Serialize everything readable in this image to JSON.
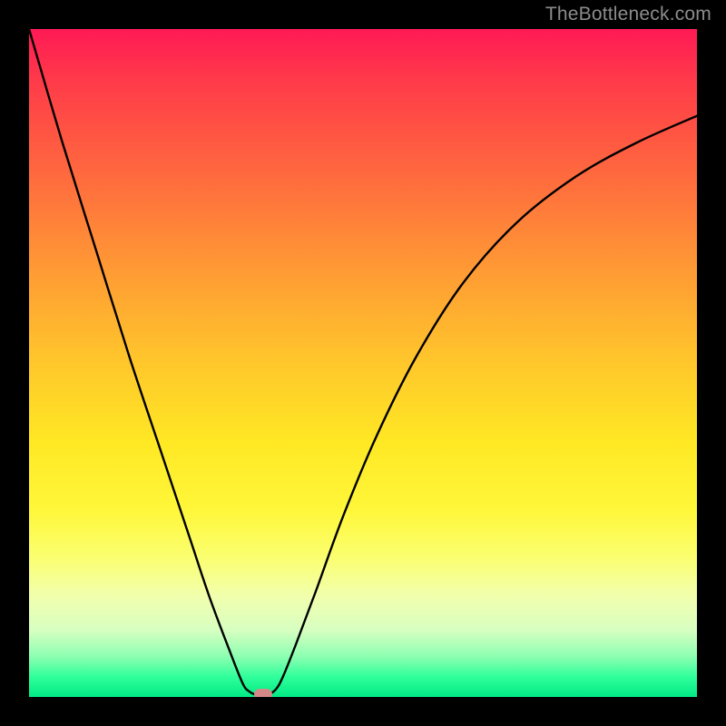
{
  "watermark": {
    "text": "TheBottleneck.com"
  },
  "colors": {
    "frame": "#000000",
    "curve": "#000000",
    "marker": "#d48888",
    "gradient_stops": [
      "#ff1a55",
      "#ff6a3e",
      "#ffc72b",
      "#fff73a",
      "#f1ffae",
      "#2fff9a",
      "#00ea86"
    ]
  },
  "chart_data": {
    "type": "line",
    "title": "",
    "xlabel": "",
    "ylabel": "",
    "xlim": [
      0,
      100
    ],
    "ylim": [
      0,
      100
    ],
    "grid": false,
    "legend": false,
    "series": [
      {
        "name": "bottleneck_curve",
        "x": [
          0,
          5,
          10,
          15,
          20,
          24,
          27,
          30,
          32,
          33,
          34,
          35,
          36,
          37,
          38,
          40,
          43,
          47,
          52,
          58,
          65,
          73,
          82,
          91,
          100
        ],
        "values": [
          100,
          83,
          67,
          51,
          36,
          24,
          15,
          7,
          2,
          0.8,
          0.3,
          0,
          0.4,
          1.2,
          3,
          8,
          16,
          27,
          39,
          51,
          62,
          71,
          78,
          83,
          87
        ]
      }
    ],
    "annotations": [
      {
        "name": "min_marker",
        "x": 35,
        "y": 0,
        "shape": "pill",
        "color": "#d48888"
      }
    ]
  }
}
